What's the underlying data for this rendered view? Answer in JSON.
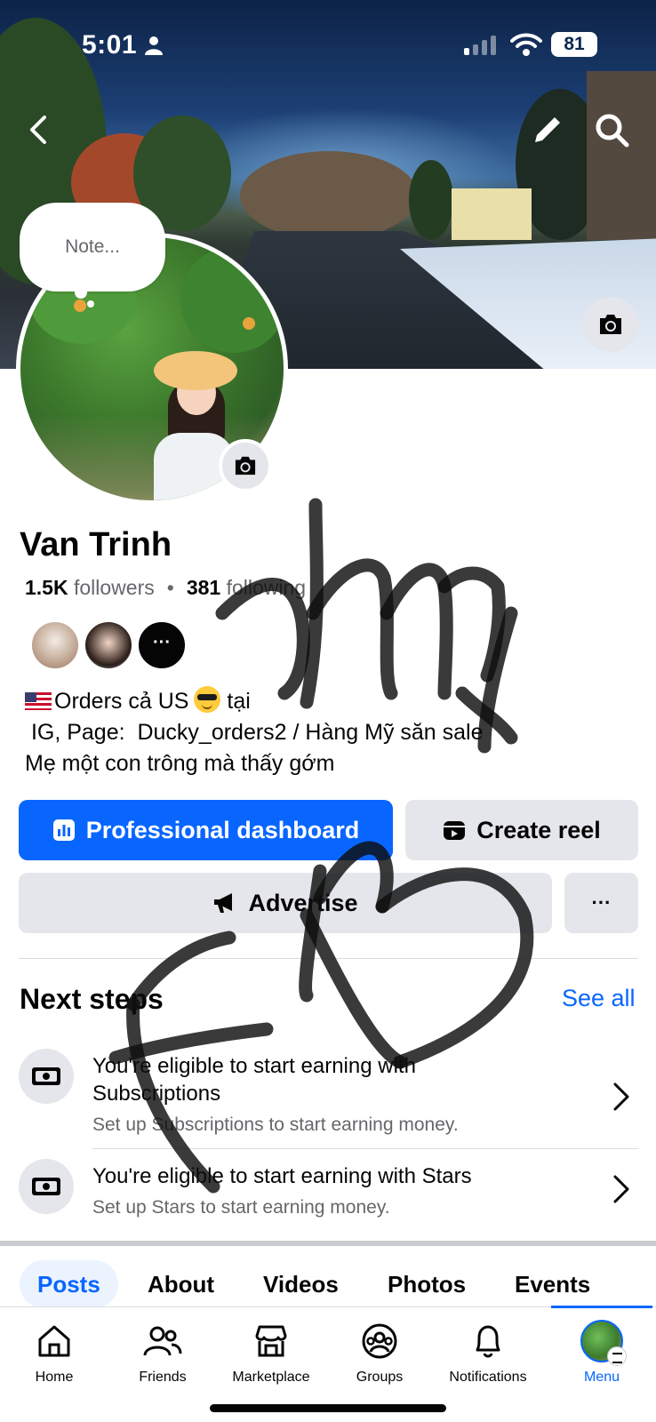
{
  "status_bar": {
    "time": "5:01",
    "battery": "81"
  },
  "cover": {
    "note_placeholder": "Note..."
  },
  "profile": {
    "name": "Van Trinh",
    "followers_count": "1.5K",
    "followers_label": "followers",
    "following_count": "381",
    "following_label": "following",
    "bio_line1": "Orders cả US",
    "bio_line1_suffix": " tại",
    "bio_line2": " IG, Page:  Ducky_orders2 / Hàng Mỹ săn sale",
    "bio_line3": "Mẹ một con trông mà thấy gớm"
  },
  "actions": {
    "professional_dashboard": "Professional dashboard",
    "create_reel": "Create reel",
    "advertise": "Advertise",
    "more": "···"
  },
  "next_steps": {
    "title": "Next steps",
    "see_all": "See all",
    "items": [
      {
        "title": "You're eligible to start earning with Subscriptions",
        "subtitle": "Set up Subscriptions to start earning money."
      },
      {
        "title": "You're eligible to start earning with Stars",
        "subtitle": "Set up Stars to start earning money."
      }
    ]
  },
  "tabs": [
    "Posts",
    "About",
    "Videos",
    "Photos",
    "Events"
  ],
  "bottom_nav": [
    "Home",
    "Friends",
    "Marketplace",
    "Groups",
    "Notifications",
    "Menu"
  ],
  "colors": {
    "accent": "#0866ff",
    "button_gray": "#e4e6eb",
    "secondary_text": "#65676b"
  }
}
